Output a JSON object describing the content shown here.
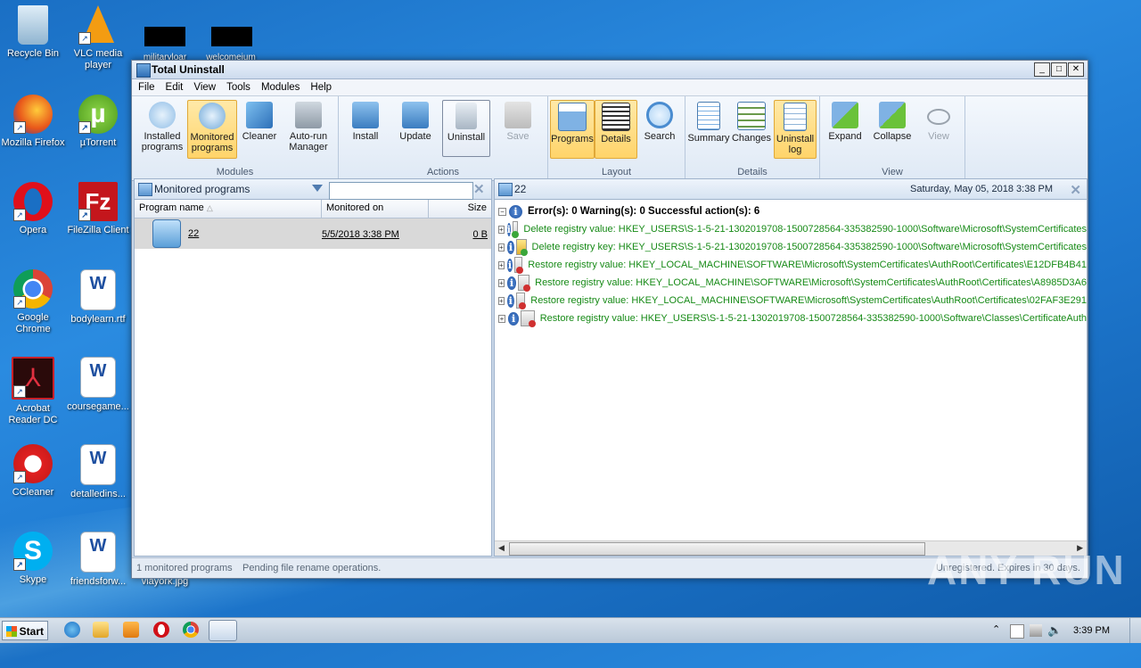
{
  "desktop": {
    "icons": [
      {
        "label": "Recycle Bin"
      },
      {
        "label": "VLC media player"
      },
      {
        "label": "Mozilla Firefox"
      },
      {
        "label": "µTorrent"
      },
      {
        "label": "Opera"
      },
      {
        "label": "FileZilla Client"
      },
      {
        "label": "Google Chrome"
      },
      {
        "label": "bodylearn.rtf"
      },
      {
        "label": "Acrobat Reader DC"
      },
      {
        "label": "coursegame..."
      },
      {
        "label": "CCleaner"
      },
      {
        "label": "detalledins..."
      },
      {
        "label": "Skype"
      },
      {
        "label": "friendsforw..."
      },
      {
        "label": "viayork.jpg"
      },
      {
        "label": "militaryloar"
      },
      {
        "label": "welcomeium"
      }
    ]
  },
  "window": {
    "title": "Total Uninstall",
    "menu": [
      "File",
      "Edit",
      "View",
      "Tools",
      "Modules",
      "Help"
    ],
    "ribbon": {
      "groups": [
        "Modules",
        "Actions",
        "Layout",
        "Details",
        "View"
      ],
      "buttons": {
        "installed": "Installed programs",
        "monitored": "Monitored programs",
        "cleaner": "Cleaner",
        "autorun": "Auto-run Manager",
        "install": "Install",
        "update": "Update",
        "uninstall": "Uninstall",
        "save": "Save",
        "programs": "Programs",
        "details": "Details",
        "search": "Search",
        "summary": "Summary",
        "changes": "Changes",
        "uninstall_log": "Uninstall log",
        "expand": "Expand",
        "collapse": "Collapse",
        "view": "View"
      }
    },
    "left_pane": {
      "title": "Monitored programs",
      "filter_placeholder": "",
      "columns": [
        "Program name",
        "Monitored on",
        "Size"
      ],
      "rows": [
        {
          "name": "22",
          "monitored_on": "5/5/2018 3:38 PM",
          "size": "0 B"
        }
      ]
    },
    "right_pane": {
      "title": "22",
      "date": "Saturday, May 05, 2018 3:38 PM",
      "summary": "Error(s): 0   Warning(s): 0   Successful action(s): 6",
      "entries": [
        "Delete registry value: HKEY_USERS\\S-1-5-21-1302019708-1500728564-335382590-1000\\Software\\Microsoft\\SystemCertificates",
        "Delete registry key: HKEY_USERS\\S-1-5-21-1302019708-1500728564-335382590-1000\\Software\\Microsoft\\SystemCertificates",
        "Restore registry value: HKEY_LOCAL_MACHINE\\SOFTWARE\\Microsoft\\SystemCertificates\\AuthRoot\\Certificates\\E12DFB4B41",
        "Restore registry value: HKEY_LOCAL_MACHINE\\SOFTWARE\\Microsoft\\SystemCertificates\\AuthRoot\\Certificates\\A8985D3A6",
        "Restore registry value: HKEY_LOCAL_MACHINE\\SOFTWARE\\Microsoft\\SystemCertificates\\AuthRoot\\Certificates\\02FAF3E291",
        "Restore registry value: HKEY_USERS\\S-1-5-21-1302019708-1500728564-335382590-1000\\Software\\Classes\\CertificateAuth"
      ]
    },
    "status": {
      "count": "1 monitored programs",
      "message": "Pending file rename operations.",
      "registration": "Unregistered. Expires in 30 days."
    }
  },
  "taskbar": {
    "start": "Start",
    "clock": "3:39 PM"
  },
  "watermark": "ANY RUN"
}
